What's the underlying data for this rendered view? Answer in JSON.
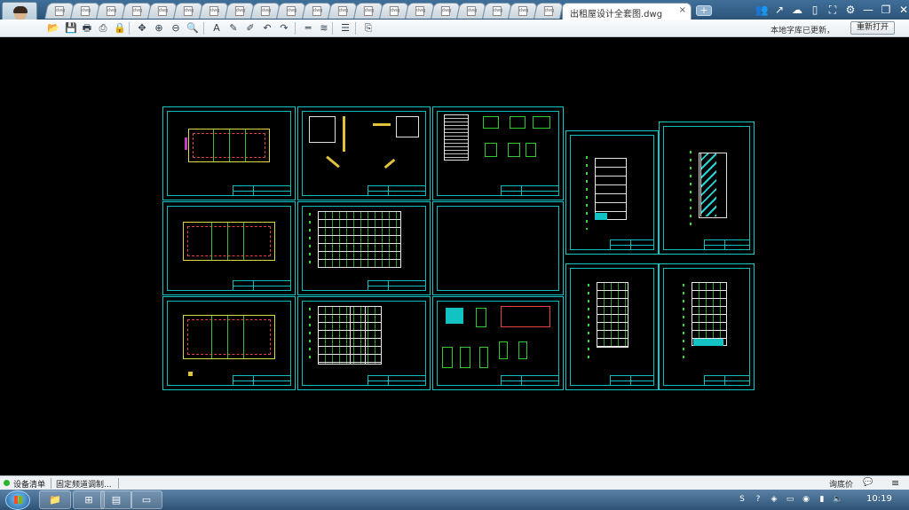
{
  "app": {
    "active_file_tab": "出租屋设计全套图.dwg",
    "close_tab_glyph": "×",
    "new_tab_glyph": "+",
    "background_file_tab_marker": "dwg",
    "background_file_tab_count": 20
  },
  "window_controls": [
    {
      "name": "users-icon",
      "glyph": "👥"
    },
    {
      "name": "share-icon",
      "glyph": "↗"
    },
    {
      "name": "cloud-icon",
      "glyph": "☁"
    },
    {
      "name": "phone-icon",
      "glyph": "▯"
    },
    {
      "name": "fullscreen-icon",
      "glyph": "⛶"
    },
    {
      "name": "settings-icon",
      "glyph": "⚙"
    },
    {
      "name": "minimize-icon",
      "glyph": "—"
    },
    {
      "name": "restore-icon",
      "glyph": "❐"
    },
    {
      "name": "close-icon",
      "glyph": "✕"
    }
  ],
  "toolbar": {
    "buttons": [
      {
        "name": "open-icon",
        "glyph": "📂"
      },
      {
        "name": "save-icon",
        "glyph": "💾"
      },
      {
        "name": "print-icon",
        "glyph": "🖶"
      },
      {
        "name": "pdf-icon",
        "glyph": "⎙"
      },
      {
        "name": "lock-icon",
        "glyph": "🔒"
      },
      {
        "name": "pan-icon",
        "glyph": "✥"
      },
      {
        "name": "zoom-in-icon",
        "glyph": "⊕"
      },
      {
        "name": "zoom-out-icon",
        "glyph": "⊖"
      },
      {
        "name": "zoom-window-icon",
        "glyph": "🔍"
      },
      {
        "name": "text-icon",
        "glyph": "A"
      },
      {
        "name": "pencil-icon",
        "glyph": "✎"
      },
      {
        "name": "highlighter-icon",
        "glyph": "✐"
      },
      {
        "name": "undo-icon",
        "glyph": "↶"
      },
      {
        "name": "redo-icon",
        "glyph": "↷"
      },
      {
        "name": "measure-icon",
        "glyph": "═"
      },
      {
        "name": "dimension-icon",
        "glyph": "≋"
      },
      {
        "name": "layers-icon",
        "glyph": "☰"
      },
      {
        "name": "export-icon",
        "glyph": "⎘"
      }
    ],
    "notice": "本地字库已更新，",
    "reopen_label": "重新打开"
  },
  "statusbar": {
    "device_list": "设备清单",
    "fixed_channel": "固定频道调制...",
    "ask_price": "询底价",
    "tool_glyph": "💬",
    "menu_glyph": "≡"
  },
  "taskbar": {
    "tasks": [
      {
        "name": "explorer-task-icon",
        "glyph": "📁"
      },
      {
        "name": "app-task-icon",
        "glyph": "⊞"
      },
      {
        "name": "stack-task-icon",
        "glyph": "▤"
      },
      {
        "name": "drawing-viewer-task-icon",
        "glyph": "▭"
      }
    ],
    "tray": [
      {
        "name": "sogou-icon",
        "glyph": "S"
      },
      {
        "name": "help-icon",
        "glyph": "?"
      },
      {
        "name": "shield-icon",
        "glyph": "◈"
      },
      {
        "name": "display-icon",
        "glyph": "▭"
      },
      {
        "name": "tray-app-icon",
        "glyph": "◉"
      },
      {
        "name": "network-icon",
        "glyph": "▮"
      },
      {
        "name": "volume-icon",
        "glyph": "🔈"
      }
    ],
    "clock": "10:19"
  },
  "colors": {
    "sheet_border": "#10c8c8",
    "canvas_bg": "#000000",
    "plan_yellow": "#d9d94a",
    "accent_green": "#32c832"
  }
}
